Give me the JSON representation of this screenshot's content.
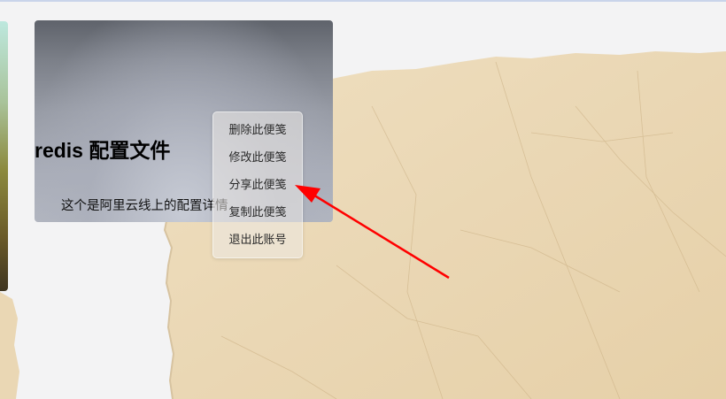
{
  "note": {
    "title": "redis 配置文件",
    "description": "这个是阿里云线上的配置详情"
  },
  "context_menu": {
    "items": [
      {
        "label": "删除此便笺"
      },
      {
        "label": "修改此便笺"
      },
      {
        "label": "分享此便笺"
      },
      {
        "label": "复制此便笺"
      },
      {
        "label": "退出此账号"
      }
    ]
  },
  "colors": {
    "paper": "#eddcbc",
    "paper_dark": "#dcc39a",
    "arrow": "#ff0000",
    "page_background": "#f3f3f4"
  },
  "icons": {
    "annotation": "red-arrow-icon"
  }
}
